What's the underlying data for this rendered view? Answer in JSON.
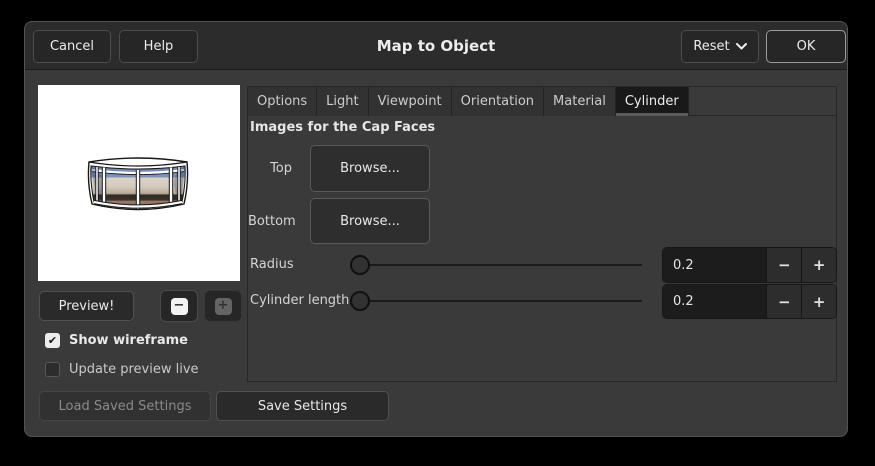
{
  "window": {
    "title": "Map to Object"
  },
  "header": {
    "cancel": "Cancel",
    "help": "Help",
    "reset": "Reset",
    "ok": "OK"
  },
  "icons": {
    "chevron_down": "chevron-down",
    "minus": "−",
    "plus": "+",
    "check": "✔",
    "zoom_out": "−",
    "zoom_in": "+"
  },
  "tabs": [
    {
      "label": "Options",
      "active": false
    },
    {
      "label": "Light",
      "active": false
    },
    {
      "label": "Viewpoint",
      "active": false
    },
    {
      "label": "Orientation",
      "active": false
    },
    {
      "label": "Material",
      "active": false
    },
    {
      "label": "Cylinder",
      "active": true
    }
  ],
  "panel": {
    "section_title": "Images for the Cap Faces",
    "rows": [
      {
        "label": "Top",
        "button": "Browse..."
      },
      {
        "label": "Bottom",
        "button": "Browse..."
      }
    ],
    "sliders": [
      {
        "label": "Radius",
        "value": "0.2"
      },
      {
        "label": "Cylinder length",
        "value": "0.2"
      }
    ]
  },
  "left": {
    "preview_button": "Preview!",
    "show_wireframe": "Show wireframe",
    "show_wireframe_checked": true,
    "update_preview_live": "Update preview live",
    "update_preview_live_checked": false
  },
  "footer": {
    "load": "Load Saved Settings",
    "load_enabled": false,
    "save": "Save Settings"
  },
  "colors": {
    "dialog_bg": "#3a3a3a",
    "header_bg": "#2c2c2c",
    "active_tab_bg": "#191919",
    "entry_bg": "#1c1c1c",
    "text": "#ececec",
    "disabled_text": "#8a8a8a",
    "preview_bg": "#ffffff"
  }
}
